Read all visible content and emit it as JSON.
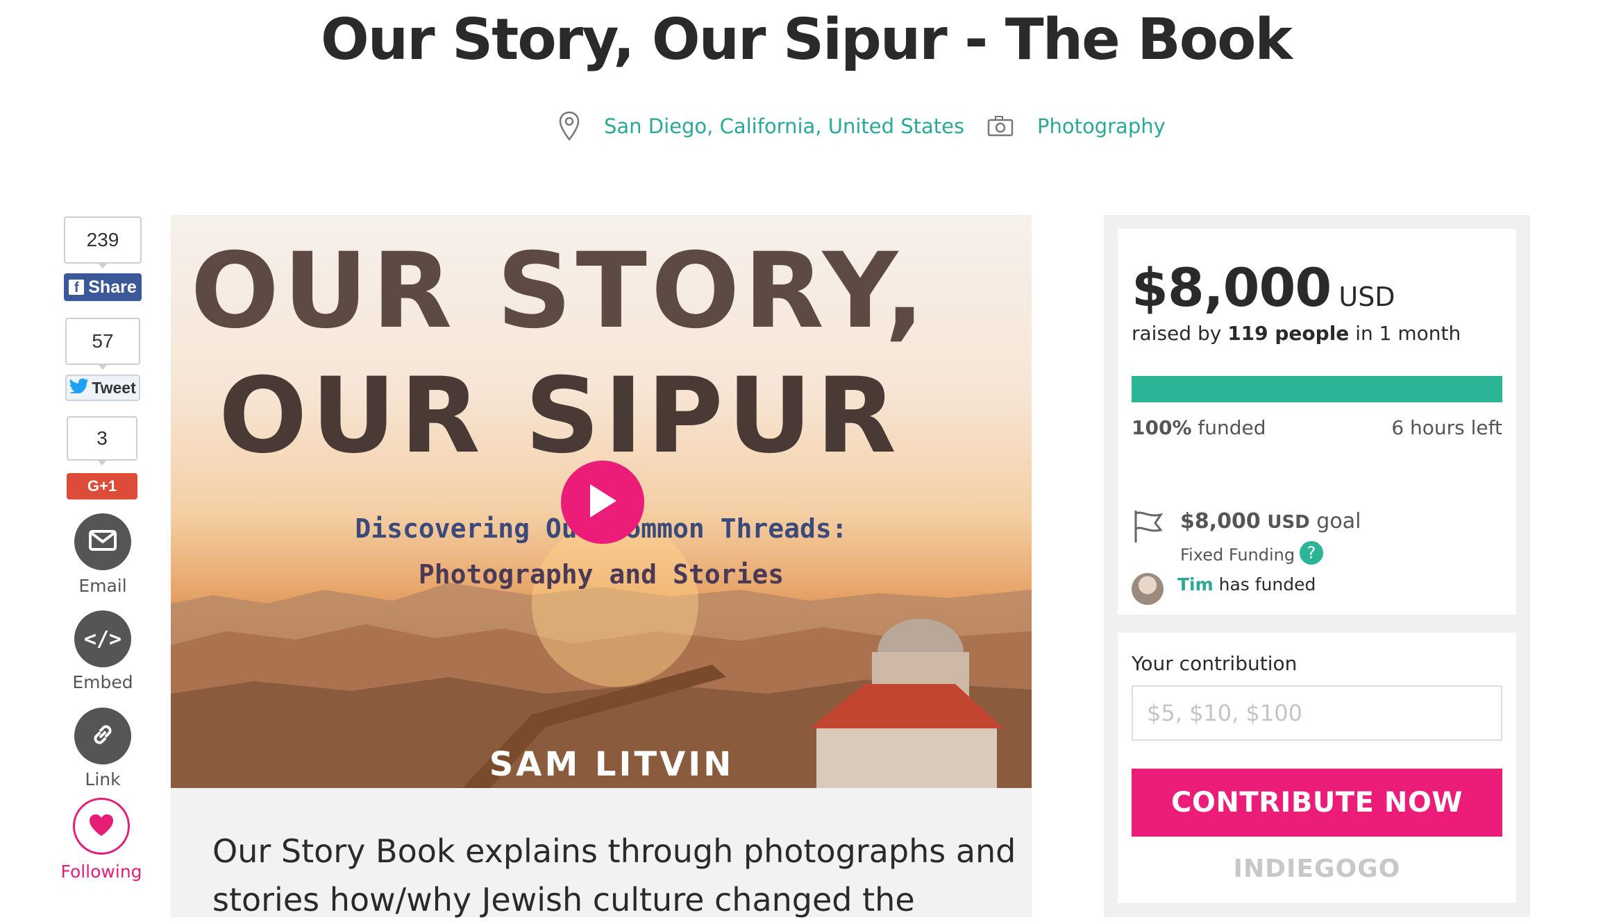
{
  "title": "Our Story, Our Sipur - The Book",
  "meta": {
    "location": "San Diego, California, United States",
    "category": "Photography",
    "location_icon": "map-pin-icon",
    "category_icon": "camera-icon"
  },
  "social": {
    "facebook": {
      "count": "239",
      "label": "Share",
      "color": "#3b5998"
    },
    "twitter": {
      "count": "57",
      "label": "Tweet"
    },
    "google": {
      "count": "3",
      "label": "G+1",
      "color": "#dd4b39"
    },
    "email_label": "Email",
    "embed_label": "Embed",
    "link_label": "Link",
    "following_label": "Following",
    "following_color": "#e51d76"
  },
  "media": {
    "title_line1": "OUR STORY,",
    "title_line2": "OUR SIPUR",
    "subtitle_line1": "Discovering Our Common Threads:",
    "subtitle_line2": "Photography and Stories",
    "author": "SAM LITVIN",
    "play_color": "#eb1d78"
  },
  "description": "Our Story Book explains through photographs and\nstories how/why Jewish culture changed the",
  "campaign": {
    "amount": "$8,000",
    "currency": "USD",
    "raised_prefix": "raised by",
    "backers": "119 people",
    "raised_suffix": "in 1 month",
    "progress_fraction": 1.0,
    "funded_pct": "100%",
    "funded_word": "funded",
    "time_left": "6 hours left",
    "goal_amount": "$8,000",
    "goal_currency": "USD",
    "goal_word": "goal",
    "funding_type": "Fixed Funding",
    "recent_backer_name": "Tim",
    "recent_backer_text": "has funded",
    "accent": "#2aa898"
  },
  "contribution": {
    "label": "Your contribution",
    "placeholder": "$5, $10, $100",
    "button": "CONTRIBUTE NOW",
    "brand": "INDIEGOGO"
  }
}
